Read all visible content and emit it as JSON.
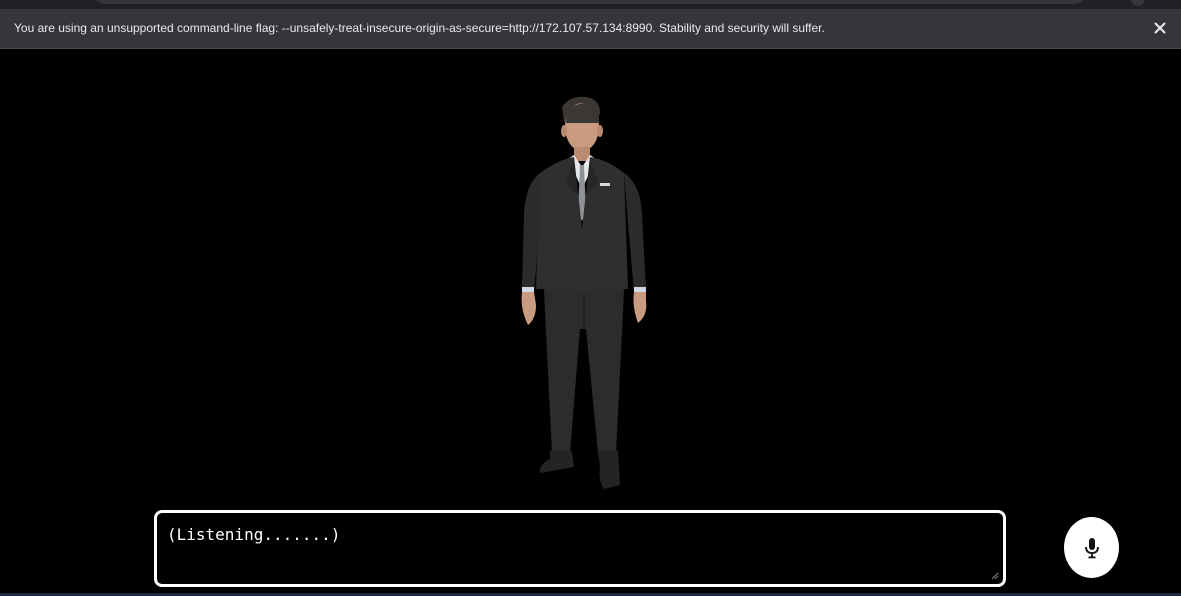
{
  "infobar": {
    "message": "You are using an unsupported command-line flag: --unsafely-treat-insecure-origin-as-secure=http://172.107.57.134:8990. Stability and security will suffer.",
    "close_icon": "close-icon"
  },
  "avatar": {
    "icon": "3d-avatar-man-in-suit"
  },
  "transcript": {
    "value": "(Listening.......)"
  },
  "mic": {
    "icon": "microphone-icon"
  },
  "colors": {
    "background": "#000000",
    "infobar_bg": "#35363a",
    "infobar_text": "#e8eaed",
    "transcript_border": "#ffffff",
    "mic_bg": "#ffffff"
  }
}
